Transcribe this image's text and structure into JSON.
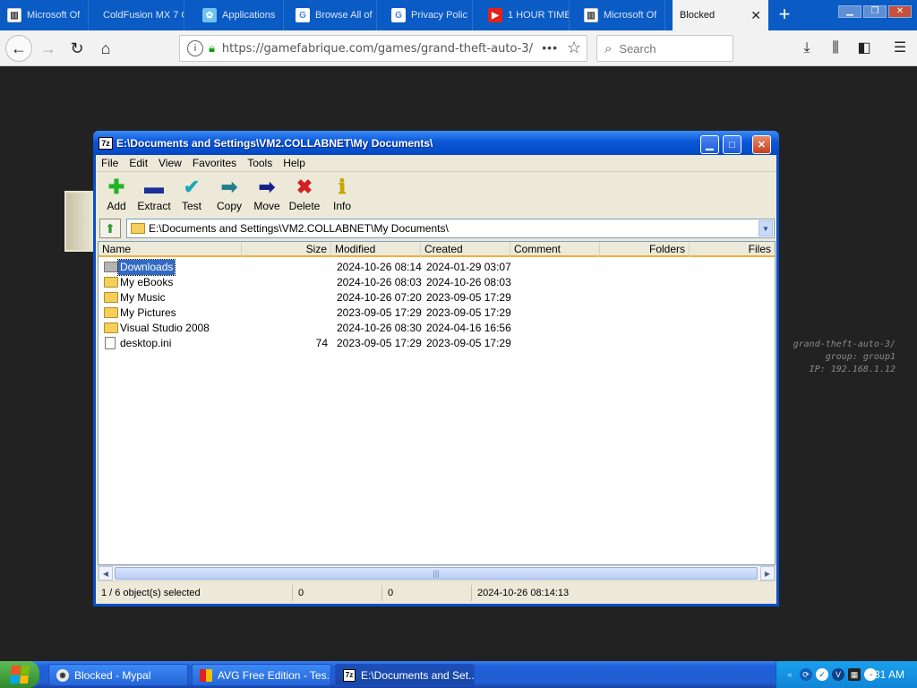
{
  "browser": {
    "tabs": [
      {
        "label": "Microsoft Of",
        "icon": "ms-office-icon",
        "active": false
      },
      {
        "label": "ColdFusion MX 7 C",
        "icon": "coldfusion-icon",
        "active": false
      },
      {
        "label": "Applications",
        "icon": "app-icon",
        "active": false
      },
      {
        "label": "Browse All of",
        "icon": "google-icon",
        "active": false
      },
      {
        "label": "Privacy Polic",
        "icon": "google-icon",
        "active": false
      },
      {
        "label": "1 HOUR TIME",
        "icon": "youtube-icon",
        "active": false
      },
      {
        "label": "Microsoft Of",
        "icon": "ms-office-icon",
        "active": false
      },
      {
        "label": "Blocked",
        "icon": "",
        "active": true
      }
    ],
    "new_tab_label": "+",
    "url": "https://gamefabrique.com/games/grand-theft-auto-3/",
    "search_placeholder": "Search"
  },
  "page": {
    "side_info": [
      "grand-theft-auto-3/",
      "group: group1",
      "IP: 192.168.1.12"
    ]
  },
  "zip": {
    "title": "E:\\Documents and Settings\\VM2.COLLABNET\\My Documents\\",
    "logo": "7z",
    "menu": [
      "File",
      "Edit",
      "View",
      "Favorites",
      "Tools",
      "Help"
    ],
    "toolbar": [
      {
        "label": "Add",
        "icon": "plus-icon",
        "color": "#22b422",
        "glyph": "✚"
      },
      {
        "label": "Extract",
        "icon": "minus-icon",
        "color": "#1a2f9a",
        "glyph": "▬"
      },
      {
        "label": "Test",
        "icon": "check-icon",
        "color": "#1ea6b8",
        "glyph": "✔"
      },
      {
        "label": "Copy",
        "icon": "arrow-right-icon",
        "color": "#1f7f8a",
        "glyph": "➡"
      },
      {
        "label": "Move",
        "icon": "arrow-right-icon",
        "color": "#14208a",
        "glyph": "➡"
      },
      {
        "label": "Delete",
        "icon": "x-icon",
        "color": "#d02020",
        "glyph": "✖"
      },
      {
        "label": "Info",
        "icon": "info-icon",
        "color": "#c8a400",
        "glyph": "ℹ"
      }
    ],
    "path": "E:\\Documents and Settings\\VM2.COLLABNET\\My Documents\\",
    "columns": [
      "Name",
      "Size",
      "Modified",
      "Created",
      "Comment",
      "Folders",
      "Files"
    ],
    "rows": [
      {
        "name": "Downloads",
        "size": "",
        "modified": "2024-10-26 08:14",
        "created": "2024-01-29 03:07",
        "type": "folder",
        "selected": true
      },
      {
        "name": "My eBooks",
        "size": "",
        "modified": "2024-10-26 08:03",
        "created": "2024-10-26 08:03",
        "type": "folder",
        "selected": false
      },
      {
        "name": "My Music",
        "size": "",
        "modified": "2024-10-26 07:20",
        "created": "2023-09-05 17:29",
        "type": "folder",
        "selected": false
      },
      {
        "name": "My Pictures",
        "size": "",
        "modified": "2023-09-05 17:29",
        "created": "2023-09-05 17:29",
        "type": "folder",
        "selected": false
      },
      {
        "name": "Visual Studio 2008",
        "size": "",
        "modified": "2024-10-26 08:30",
        "created": "2024-04-16 16:56",
        "type": "folder",
        "selected": false
      },
      {
        "name": "desktop.ini",
        "size": "74",
        "modified": "2023-09-05 17:29",
        "created": "2023-09-05 17:29",
        "type": "file",
        "selected": false
      }
    ],
    "status": {
      "selection": "1 / 6 object(s) selected",
      "size": "0",
      "packed": "0",
      "datetime": "2024-10-26 08:14:13"
    }
  },
  "taskbar": {
    "items": [
      {
        "label": "Blocked - Mypal",
        "icon": "mypal-icon",
        "active": false
      },
      {
        "label": "AVG Free Edition - Tes...",
        "icon": "avg-icon",
        "active": false
      },
      {
        "label": "E:\\Documents and Set...",
        "icon": "7zip-icon",
        "active": true
      }
    ],
    "clock": "8:31 AM"
  }
}
